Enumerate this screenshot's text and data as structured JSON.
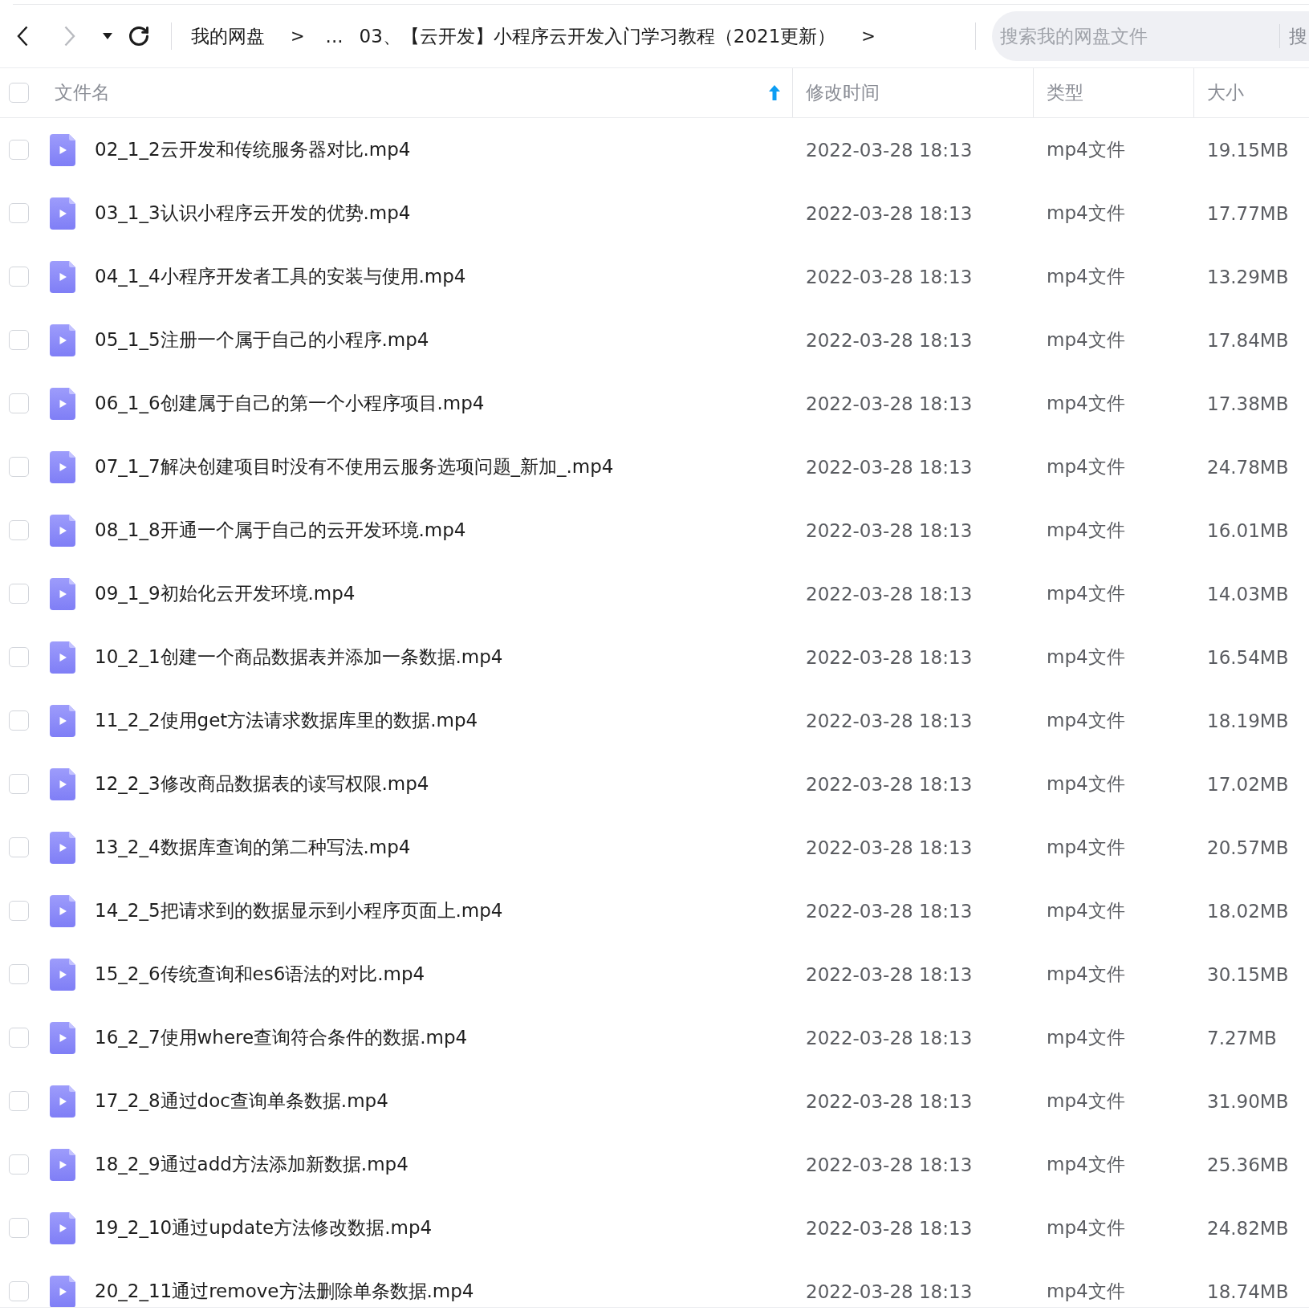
{
  "toolbar": {
    "back": {
      "disabled": false
    },
    "forward": {
      "disabled": true
    },
    "breadcrumb": [
      {
        "label": "我的网盘",
        "separator": ">"
      },
      {
        "label": "..."
      },
      {
        "label": "03、【云开发】小程序云开发入门学习教程（2021更新）",
        "separator": ">"
      }
    ],
    "search": {
      "placeholder": "搜索我的网盘文件",
      "button": "搜"
    }
  },
  "table": {
    "select_all": {
      "checked": false
    },
    "columns": [
      {
        "label": "文件名",
        "sorted": true,
        "ascending": true
      },
      {
        "label": "修改时间",
        "sorted": false
      },
      {
        "label": "类型",
        "sorted": false
      },
      {
        "label": "大小",
        "sorted": false
      }
    ],
    "rows": [
      {
        "name": "02_1_2云开发和传统服务器对比.mp4",
        "modified": "2022-03-28 18:13",
        "type": "mp4文件",
        "size": "19.15MB",
        "checked": false
      },
      {
        "name": "03_1_3认识小程序云开发的优势.mp4",
        "modified": "2022-03-28 18:13",
        "type": "mp4文件",
        "size": "17.77MB",
        "checked": false
      },
      {
        "name": "04_1_4小程序开发者工具的安装与使用.mp4",
        "modified": "2022-03-28 18:13",
        "type": "mp4文件",
        "size": "13.29MB",
        "checked": false
      },
      {
        "name": "05_1_5注册一个属于自己的小程序.mp4",
        "modified": "2022-03-28 18:13",
        "type": "mp4文件",
        "size": "17.84MB",
        "checked": false
      },
      {
        "name": "06_1_6创建属于自己的第一个小程序项目.mp4",
        "modified": "2022-03-28 18:13",
        "type": "mp4文件",
        "size": "17.38MB",
        "checked": false
      },
      {
        "name": "07_1_7解决创建项目时没有不使用云服务选项问题_新加_.mp4",
        "modified": "2022-03-28 18:13",
        "type": "mp4文件",
        "size": "24.78MB",
        "checked": false
      },
      {
        "name": "08_1_8开通一个属于自己的云开发环境.mp4",
        "modified": "2022-03-28 18:13",
        "type": "mp4文件",
        "size": "16.01MB",
        "checked": false
      },
      {
        "name": "09_1_9初始化云开发环境.mp4",
        "modified": "2022-03-28 18:13",
        "type": "mp4文件",
        "size": "14.03MB",
        "checked": false
      },
      {
        "name": "10_2_1创建一个商品数据表并添加一条数据.mp4",
        "modified": "2022-03-28 18:13",
        "type": "mp4文件",
        "size": "16.54MB",
        "checked": false
      },
      {
        "name": "11_2_2使用get方法请求数据库里的数据.mp4",
        "modified": "2022-03-28 18:13",
        "type": "mp4文件",
        "size": "18.19MB",
        "checked": false
      },
      {
        "name": "12_2_3修改商品数据表的读写权限.mp4",
        "modified": "2022-03-28 18:13",
        "type": "mp4文件",
        "size": "17.02MB",
        "checked": false
      },
      {
        "name": "13_2_4数据库查询的第二种写法.mp4",
        "modified": "2022-03-28 18:13",
        "type": "mp4文件",
        "size": "20.57MB",
        "checked": false
      },
      {
        "name": "14_2_5把请求到的数据显示到小程序页面上.mp4",
        "modified": "2022-03-28 18:13",
        "type": "mp4文件",
        "size": "18.02MB",
        "checked": false
      },
      {
        "name": "15_2_6传统查询和es6语法的对比.mp4",
        "modified": "2022-03-28 18:13",
        "type": "mp4文件",
        "size": "30.15MB",
        "checked": false
      },
      {
        "name": "16_2_7使用where查询符合条件的数据.mp4",
        "modified": "2022-03-28 18:13",
        "type": "mp4文件",
        "size": "7.27MB",
        "checked": false
      },
      {
        "name": "17_2_8通过doc查询单条数据.mp4",
        "modified": "2022-03-28 18:13",
        "type": "mp4文件",
        "size": "31.90MB",
        "checked": false
      },
      {
        "name": "18_2_9通过add方法添加新数据.mp4",
        "modified": "2022-03-28 18:13",
        "type": "mp4文件",
        "size": "25.36MB",
        "checked": false
      },
      {
        "name": "19_2_10通过update方法修改数据.mp4",
        "modified": "2022-03-28 18:13",
        "type": "mp4文件",
        "size": "24.82MB",
        "checked": false
      },
      {
        "name": "20_2_11通过remove方法删除单条数据.mp4",
        "modified": "2022-03-28 18:13",
        "type": "mp4文件",
        "size": "18.74MB",
        "checked": false
      }
    ]
  }
}
